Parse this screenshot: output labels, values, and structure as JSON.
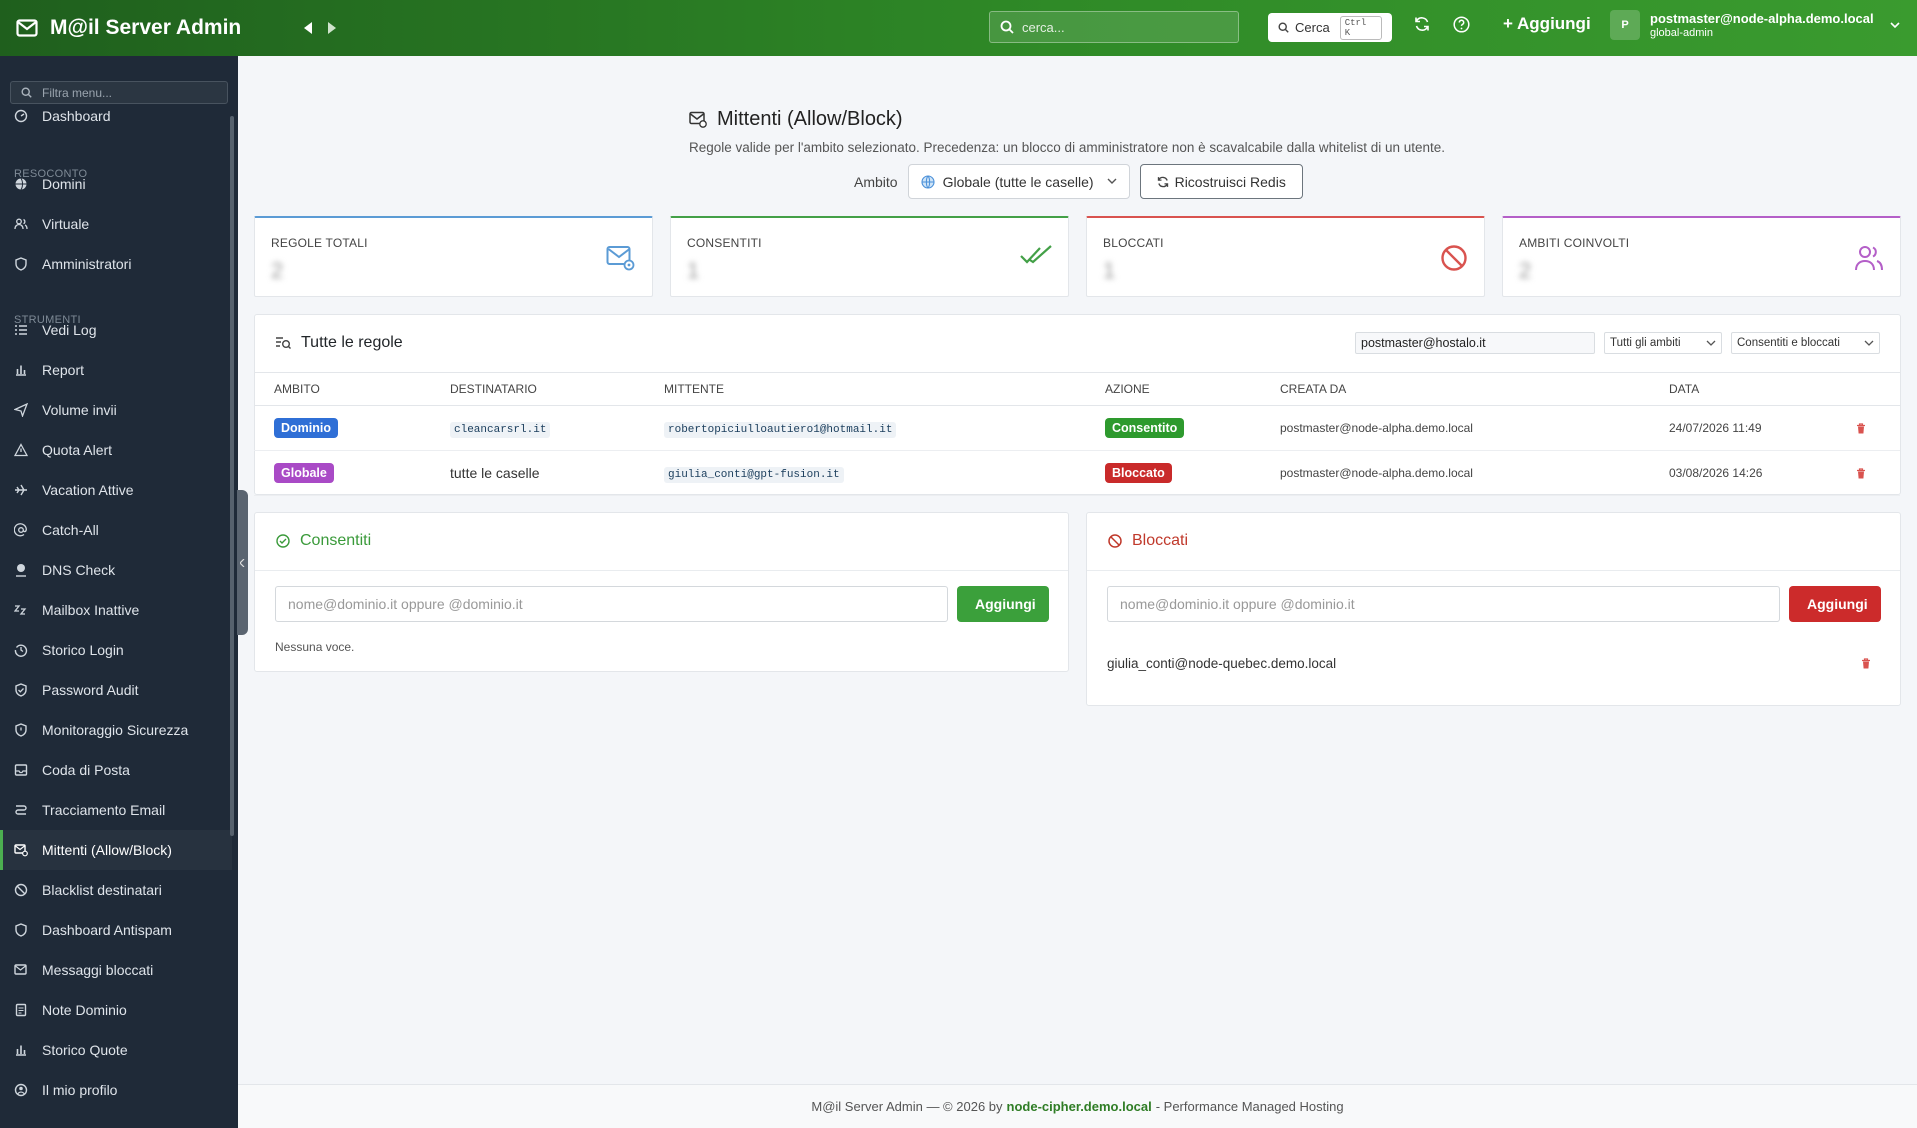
{
  "app": {
    "title": "M@il Server Admin"
  },
  "topbar": {
    "search_placeholder": "cerca...",
    "cerca_label": "Cerca",
    "cerca_shortcut": "Ctrl K",
    "add_label": "+ Aggiungi",
    "user_initial": "P",
    "user_email": "postmaster@node-alpha.demo.local",
    "user_role": "global-admin",
    "icons": [
      "mail-icon",
      "chevron-left-icon",
      "chevron-right-icon",
      "search-icon",
      "refresh-icon",
      "help-icon",
      "chevron-down-icon"
    ]
  },
  "sidebar": {
    "filter_placeholder": "Filtra menu...",
    "sections": {
      "resoconto": "RESOCONTO",
      "strumenti": "STRUMENTI"
    },
    "items": [
      {
        "label": "Dashboard",
        "icon": "gauge-icon"
      },
      {
        "label": "Domini",
        "icon": "globe-icon"
      },
      {
        "label": "Virtuale",
        "icon": "users-icon"
      },
      {
        "label": "Amministratori",
        "icon": "shield-icon"
      },
      {
        "label": "Vedi Log",
        "icon": "list-icon"
      },
      {
        "label": "Report",
        "icon": "bar-chart-icon"
      },
      {
        "label": "Volume invii",
        "icon": "send-icon"
      },
      {
        "label": "Quota Alert",
        "icon": "warning-icon"
      },
      {
        "label": "Vacation Attive",
        "icon": "plane-icon"
      },
      {
        "label": "Catch-All",
        "icon": "at-icon"
      },
      {
        "label": "DNS Check",
        "icon": "pin-icon"
      },
      {
        "label": "Mailbox Inattive",
        "icon": "sleep-icon"
      },
      {
        "label": "Storico Login",
        "icon": "history-icon"
      },
      {
        "label": "Password Audit",
        "icon": "shield-check-icon"
      },
      {
        "label": "Monitoraggio Sicurezza",
        "icon": "shield-alert-icon"
      },
      {
        "label": "Coda di Posta",
        "icon": "inbox-icon"
      },
      {
        "label": "Tracciamento Email",
        "icon": "route-icon"
      },
      {
        "label": "Mittenti (Allow/Block)",
        "icon": "mail-gear-icon"
      },
      {
        "label": "Blacklist destinatari",
        "icon": "ban-icon"
      },
      {
        "label": "Dashboard Antispam",
        "icon": "shield-icon"
      },
      {
        "label": "Messaggi bloccati",
        "icon": "mail-x-icon"
      },
      {
        "label": "Note Dominio",
        "icon": "note-icon"
      },
      {
        "label": "Storico Quote",
        "icon": "bar-chart-icon"
      },
      {
        "label": "Il mio profilo",
        "icon": "user-circle-icon"
      }
    ],
    "active": "Mittenti (Allow/Block)"
  },
  "page": {
    "title": "Mittenti (Allow/Block)",
    "subtitle": "Regole valide per l'ambito selezionato. Precedenza: un blocco di amministratore non è scavalcabile dalla whitelist di un utente.",
    "ambito_label": "Ambito",
    "ambito_value": "Globale (tutte le caselle)",
    "rebuild_label": "Ricostruisci Redis"
  },
  "stats": [
    {
      "label": "REGOLE TOTALI",
      "value": "2",
      "color": "#5b9bd5",
      "icon": "mail-gear-icon"
    },
    {
      "label": "CONSENTITI",
      "value": "1",
      "color": "#43a047",
      "icon": "double-check-icon"
    },
    {
      "label": "BLOCCATI",
      "value": "1",
      "color": "#d9534f",
      "icon": "ban-icon"
    },
    {
      "label": "AMBITI COINVOLTI",
      "value": "2",
      "color": "#b45fc8",
      "icon": "users-icon"
    }
  ],
  "rules": {
    "title": "Tutte le regole",
    "filter_value": "postmaster@hostalo.it",
    "scope_filter": "Tutti gli ambiti",
    "type_filter": "Consentiti e bloccati",
    "columns": [
      "AMBITO",
      "DESTINATARIO",
      "MITTENTE",
      "AZIONE",
      "CREATA DA",
      "DATA"
    ],
    "rows": [
      {
        "ambito": "Dominio",
        "destinatario": "cleancarsrl.it",
        "mittente": "robertopiciulloautiero1@hotmail.it",
        "azione": "Consentito",
        "creata_da": "postmaster@node-alpha.demo.local",
        "data": "24/07/2026 11:49"
      },
      {
        "ambito": "Globale",
        "destinatario": "tutte le caselle",
        "mittente": "giulia_conti@gpt-fusion.it",
        "azione": "Bloccato",
        "creata_da": "postmaster@node-alpha.demo.local",
        "data": "03/08/2026 14:26"
      }
    ]
  },
  "allowed": {
    "title": "Consentiti",
    "placeholder": "nome@dominio.it oppure @dominio.it",
    "button": "Aggiungi",
    "empty": "Nessuna voce."
  },
  "blocked": {
    "title": "Bloccati",
    "placeholder": "nome@dominio.it oppure @dominio.it",
    "button": "Aggiungi",
    "entries": [
      "giulia_conti@node-quebec.demo.local"
    ]
  },
  "footer": {
    "prefix": "M@il Server Admin — © 2026 by",
    "host": "node-cipher.demo.local",
    "suffix": "- Performance Managed Hosting"
  },
  "colors": {
    "brand": "#2f8a27",
    "sidebar": "#1f2a38",
    "dominio_badge": "#2f6fd6",
    "globale_badge": "#a94ac6",
    "allow": "#2e9a2e",
    "block": "#c92a2a"
  }
}
